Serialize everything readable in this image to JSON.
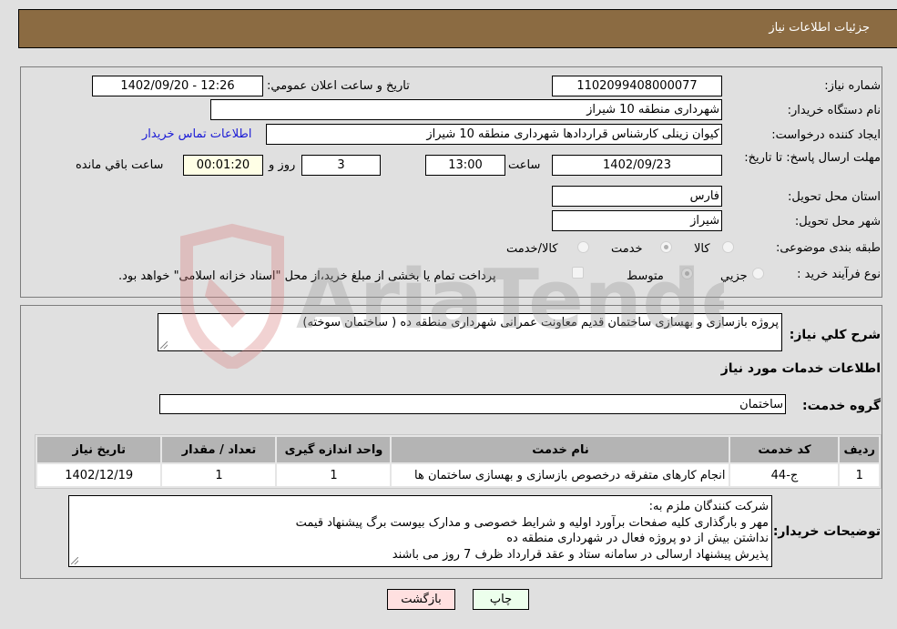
{
  "header": {
    "title": "جزئیات اطلاعات نیاز"
  },
  "form": {
    "need_number": {
      "label": "شماره نیاز:",
      "value": "1102099408000077"
    },
    "announce_datetime": {
      "label": "تاریخ و ساعت اعلان عمومي:",
      "value": "1402/09/20 - 12:26"
    },
    "buyer_org": {
      "label": "نام دستگاه خريدار:",
      "value": "شهرداری منطقه 10 شیراز"
    },
    "requester": {
      "label": "ایجاد کننده درخواست:",
      "value": "کیوان زینلی کارشناس قراردادها شهرداری منطقه 10 شیراز"
    },
    "buyer_contact_link": "اطلاعات تماس خريدار",
    "deadline": {
      "label": "مهلت ارسال پاسخ: تا تاریخ:",
      "date": "1402/09/23",
      "time_label": "ساعت",
      "time": "13:00",
      "days": "3",
      "days_label": "روز و",
      "remaining": "00:01:20",
      "remaining_label": "ساعت باقي مانده"
    },
    "province": {
      "label": "استان محل تحویل:",
      "value": "فارس"
    },
    "city": {
      "label": "شهر محل تحویل:",
      "value": "شیراز"
    },
    "category": {
      "label": "طبقه بندی موضوعی:",
      "options": [
        {
          "label": "کالا",
          "checked": false
        },
        {
          "label": "خدمت",
          "checked": true
        },
        {
          "label": "کالا/خدمت",
          "checked": false
        }
      ]
    },
    "purchase_type": {
      "label": "نوع فرآیند خرید :",
      "options": [
        {
          "label": "جزيي",
          "checked": false
        },
        {
          "label": "متوسط",
          "checked": true
        }
      ],
      "treasury_note": "پرداخت تمام یا بخشی از مبلغ خرید،از محل \"اسناد خزانه اسلامی\" خواهد بود.",
      "treasury_checked": false
    }
  },
  "details": {
    "general_desc_label": "شرح كلي نياز:",
    "general_desc": "پروژه بازسازی و بهسازی ساختمان قدیم معاونت عمرانی شهرداری  منطقه ده ( ساختمان سوخته)",
    "services_title": "اطلاعات خدمات مورد نیاز",
    "service_group_label": "گروه خدمت:",
    "service_group": "ساختمان",
    "table": {
      "headers": [
        "ردیف",
        "کد خدمت",
        "نام خدمت",
        "واحد اندازه گیری",
        "تعداد / مقدار",
        "تاریخ نیاز"
      ],
      "rows": [
        [
          "1",
          "ج-44",
          "انجام کارهای متفرقه درخصوص بازسازی و بهسازی ساختمان ها",
          "1",
          "1",
          "1402/12/19"
        ]
      ]
    },
    "buyer_notes_label": "توضیحات خریدار:",
    "buyer_notes": [
      "شرکت کنندگان ملزم به:",
      "مهر و بارگذاری کلیه صفحات برآورد اولیه و شرایط خصوصی و مدارک بیوست برگ پیشنهاد قیمت",
      "نداشتن بیش از دو پروژه فعال در شهرداری منطقه ده",
      "پذیرش پیشنهاد ارسالی در سامانه ستاد و عقد قرارداد ظرف 7 روز می باشند"
    ]
  },
  "buttons": {
    "print": "چاپ",
    "back": "بازگشت"
  },
  "colors": {
    "header_bg": "#8b6b42",
    "print_bg": "#ecffec",
    "back_bg": "#ffe0e0",
    "link": "#1a1ad6"
  },
  "watermark": {
    "text": "AriaTender.neT"
  }
}
